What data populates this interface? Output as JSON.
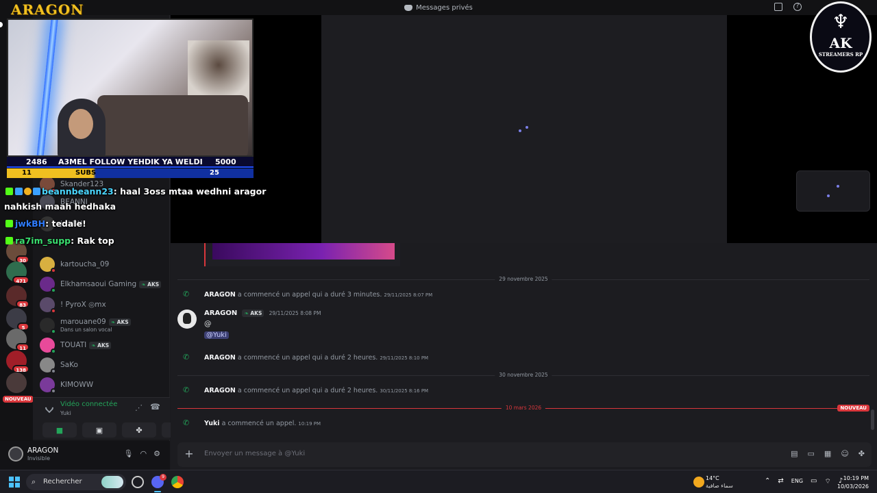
{
  "titlebar": {
    "title": "Messages privés"
  },
  "overlay": {
    "logo": "ARAGON",
    "ticker_left": "2486",
    "ticker_text": "A3MEL FOLLOW YEHDIK YA WELDI",
    "ticker_right": "5000",
    "subs_left": "11",
    "subs_label": "SUBS",
    "subs_right": "25",
    "ak_logo_main": "AK",
    "ak_logo_sub": "STREAMERS RP"
  },
  "stream_chat": [
    {
      "user": "beannbeann23",
      "text": ": haal 3oss mtaa wedhni aragor"
    },
    {
      "user": "",
      "text": "nahkish maah hedhaka"
    },
    {
      "user": "jwkBH",
      "text": ": tedale!"
    },
    {
      "user": "ra7im_supp",
      "text": ": Rak top"
    }
  ],
  "servers": {
    "badges": [
      "30",
      "471",
      "83",
      "5",
      "11",
      "138"
    ],
    "nouveau": "NOUVEAU"
  },
  "dms": [
    {
      "name": "Skander123",
      "sub": "",
      "tag": ""
    },
    {
      "name": "BEANNI",
      "sub": "",
      "tag": ""
    },
    {
      "name": "jwkBH",
      "sub": "",
      "tag": ""
    },
    {
      "name": "kartoucha_09",
      "sub": "",
      "tag": ""
    },
    {
      "name": "Elkhamsaoui Gaming",
      "sub": "",
      "tag": "AKS"
    },
    {
      "name": "! PyroX ◎mx",
      "sub": "",
      "tag": ""
    },
    {
      "name": "marouane09",
      "sub": "Dans un salon vocal",
      "tag": "AKS"
    },
    {
      "name": "TOUATI",
      "sub": "",
      "tag": "AKS"
    },
    {
      "name": "SaKo",
      "sub": "",
      "tag": ""
    },
    {
      "name": "KIMOWW",
      "sub": "",
      "tag": ""
    }
  ],
  "voice": {
    "title": "Vidéo connectée",
    "subtitle": "Yuki"
  },
  "user": {
    "name": "ARAGON",
    "status": "Invisible"
  },
  "chat": {
    "dividers": {
      "d1": "29 novembre 2025",
      "d2": "30 novembre 2025",
      "d3": "10 mars 2026",
      "new_badge": "NOUVEAU"
    },
    "sys": [
      {
        "who": "ARAGON",
        "text": "a commencé un appel qui a duré 3 minutes.",
        "time": "29/11/2025 8:07 PM"
      },
      {
        "who": "ARAGON",
        "text": "a commencé un appel qui a duré 2 heures.",
        "time": "29/11/2025 8:10 PM"
      },
      {
        "who": "ARAGON",
        "text": "a commencé un appel qui a duré 2 heures.",
        "time": "30/11/2025 8:16 PM"
      },
      {
        "who": "Yuki",
        "text": "a commencé un appel.",
        "time": "10:19 PM"
      }
    ],
    "message": {
      "author": "ARAGON",
      "tag": "AKS",
      "time": "29/11/2025 8:08 PM",
      "body": "@",
      "mention": "@Yuki"
    },
    "composer_placeholder": "Envoyer un message à @Yuki"
  },
  "taskbar": {
    "search": "Rechercher",
    "discord_badge": "9",
    "weather_temp": "14°C",
    "weather_desc": "سماء صافية",
    "lang": "ENG",
    "time": "10:19 PM",
    "date": "10/03/2026"
  },
  "colors": {
    "accent_green": "#23a55a",
    "alert_red": "#da373c",
    "mention_bg": "#3c3f73"
  }
}
